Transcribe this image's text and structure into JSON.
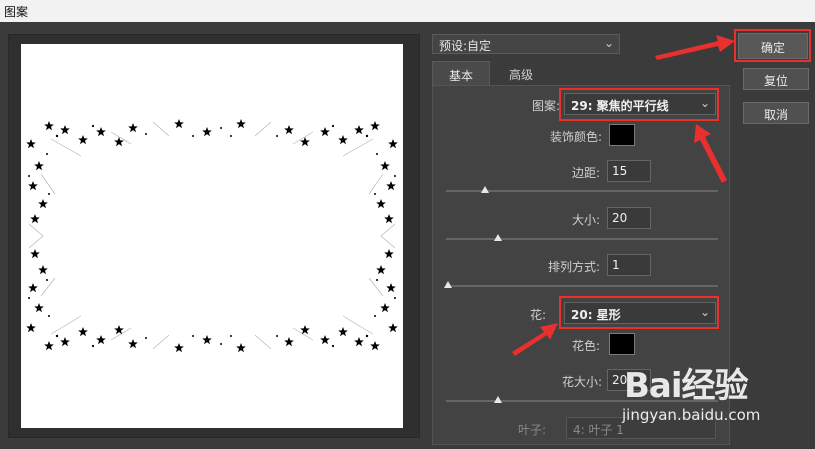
{
  "window": {
    "title": "图案"
  },
  "preset": {
    "label": "预设:",
    "value": "自定"
  },
  "tabs": [
    {
      "label": "基本"
    },
    {
      "label": "高级"
    }
  ],
  "form": {
    "pattern_label": "图案:",
    "pattern_value": "29: 聚焦的平行线",
    "decor_color_label": "装饰颜色:",
    "margin_label": "边距:",
    "margin_value": "15",
    "size_label": "大小:",
    "size_value": "20",
    "arrange_label": "排列方式:",
    "arrange_value": "1",
    "flower_label": "花:",
    "flower_value": "20: 星形",
    "flower_color_label": "花色:",
    "flower_size_label": "花大小:",
    "flower_size_value": "20",
    "leaf_label": "叶子:",
    "leaf_value": "4: 叶子 1"
  },
  "sliders": {
    "margin_level": 0.14,
    "size_level": 0.19,
    "arrange_level": 0.0,
    "flower_size_level": 0.19
  },
  "buttons": {
    "ok": "确定",
    "reset": "复位",
    "cancel": "取消"
  },
  "watermark": {
    "brand": "Bai经验",
    "url": "jingyan.baidu.com"
  },
  "colors": {
    "highlight": "#e8302e",
    "decor_color": "#000000",
    "flower_color": "#000000"
  }
}
